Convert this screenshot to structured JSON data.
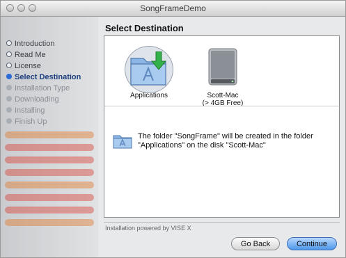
{
  "window": {
    "title": "SongFrameDemo"
  },
  "section_title": "Select Destination",
  "steps": [
    {
      "label": "Introduction",
      "state": "done"
    },
    {
      "label": "Read Me",
      "state": "done"
    },
    {
      "label": "License",
      "state": "done"
    },
    {
      "label": "Select Destination",
      "state": "current"
    },
    {
      "label": "Installation Type",
      "state": "pending"
    },
    {
      "label": "Downloading",
      "state": "pending"
    },
    {
      "label": "Installing",
      "state": "pending"
    },
    {
      "label": "Finish Up",
      "state": "pending"
    }
  ],
  "destinations": [
    {
      "name": "Applications",
      "sub": "",
      "icon": "applications-folder-icon",
      "selected": true
    },
    {
      "name": "Scott-Mac",
      "sub": "(> 4GB Free)",
      "icon": "hard-disk-icon",
      "selected": false
    }
  ],
  "message": "The folder \"SongFrame\" will be created in the folder \"Applications\" on the disk \"Scott-Mac\"",
  "footer": "Installation powered by VISE X",
  "buttons": {
    "back": "Go Back",
    "continue": "Continue"
  },
  "colors": {
    "accent": "#2c6ad6",
    "continue_button": "#4d97ea",
    "panel": "#ffffff"
  }
}
